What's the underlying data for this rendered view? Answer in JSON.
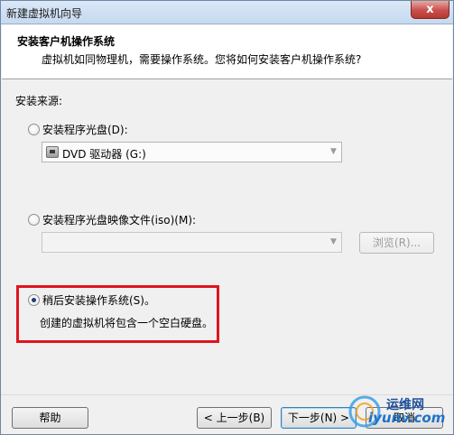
{
  "window": {
    "title": "新建虚拟机向导",
    "close_label": "x"
  },
  "header": {
    "title": "安装客户机操作系统",
    "description": "虚拟机如同物理机，需要操作系统。您将如何安装客户机操作系统?"
  },
  "source": {
    "label": "安装来源:",
    "options": [
      {
        "label": "安装程序光盘(D):",
        "selected": false
      },
      {
        "label": "安装程序光盘映像文件(iso)(M):",
        "selected": false
      },
      {
        "label": "稍后安装操作系统(S)。",
        "selected": true
      }
    ],
    "disc_drive": {
      "value": "DVD 驱动器 (G:)",
      "icon": "dvd-drive-icon"
    },
    "iso_path": {
      "value": ""
    },
    "browse_label": "浏览(R)...",
    "later_note": "创建的虚拟机将包含一个空白硬盘。"
  },
  "footer": {
    "help_label": "帮助",
    "back_label": "< 上一步(B)",
    "next_label": "下一步(N) >",
    "cancel_label": "取消"
  },
  "watermark": {
    "line1": "运维网",
    "line2": "iyunv.com"
  },
  "colors": {
    "highlight_box": "#e0141e",
    "header_bg": "#ffffff",
    "dialog_bg": "#f0f0f0"
  }
}
